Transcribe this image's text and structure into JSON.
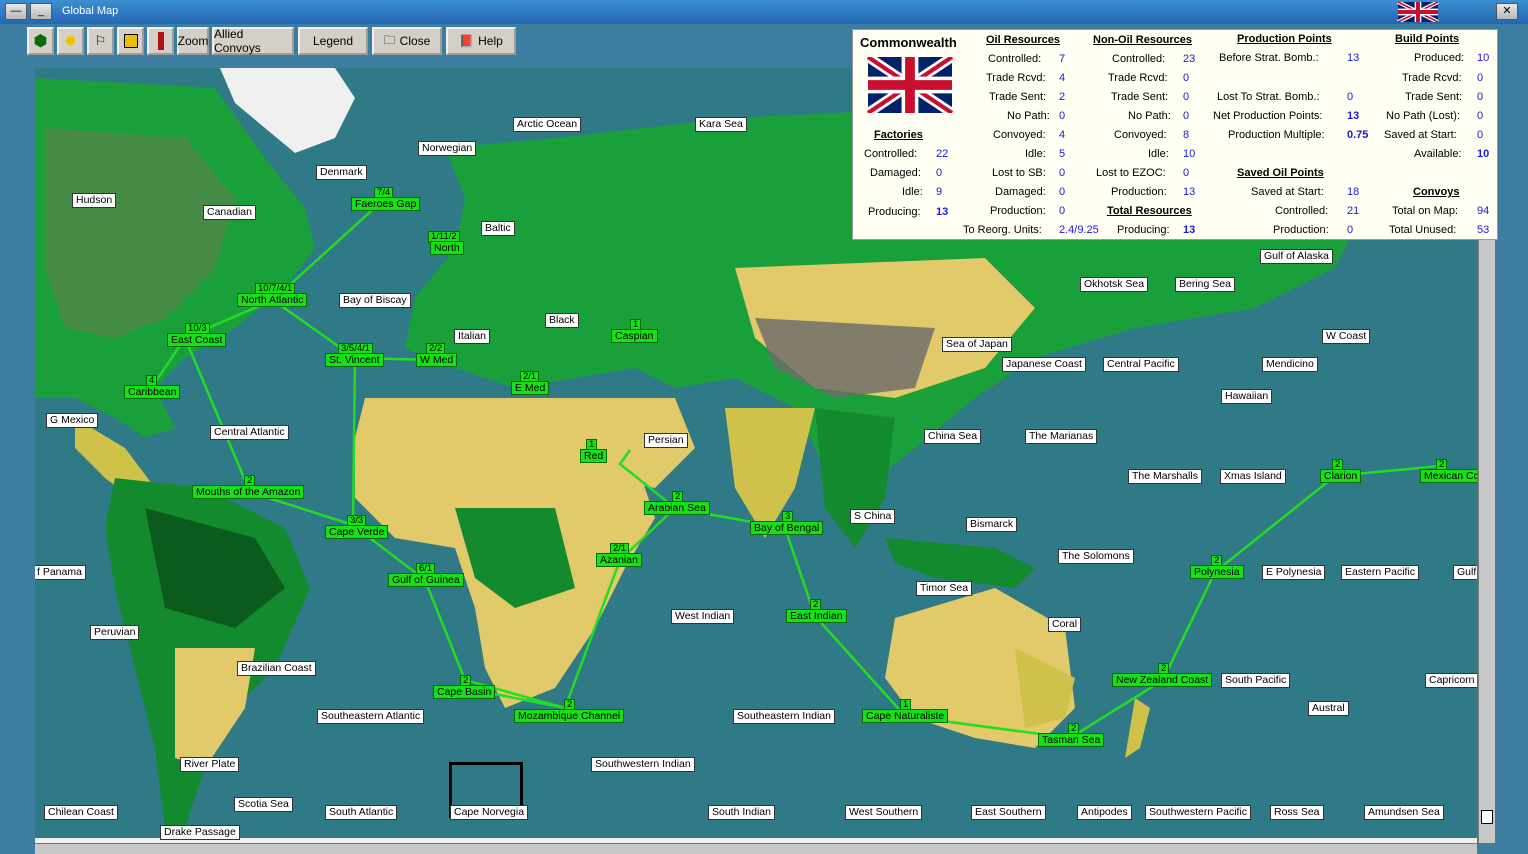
{
  "window": {
    "title": "Global Map"
  },
  "toolbar": {
    "zoom": "Zoom",
    "allied_convoys": "Allied Convoys",
    "legend": "Legend",
    "close": "Close",
    "help": "Help"
  },
  "panel": {
    "nation": "Commonwealth",
    "oil": {
      "header": "Oil Resources",
      "controlled_l": "Controlled:",
      "controlled": "7",
      "trade_rcvd_l": "Trade Rcvd:",
      "trade_rcvd": "4",
      "trade_sent_l": "Trade Sent:",
      "trade_sent": "2",
      "no_path_l": "No Path:",
      "no_path": "0",
      "convoyed_l": "Convoyed:",
      "convoyed": "4",
      "idle_l": "Idle:",
      "idle": "5",
      "lost_sb_l": "Lost to SB:",
      "lost_sb": "0",
      "damaged_l": "Damaged:",
      "damaged": "0",
      "production_l": "Production:",
      "production": "0",
      "reorg_l": "To Reorg. Units:",
      "reorg": "2.4/9.25"
    },
    "nonoil": {
      "header": "Non-Oil Resources",
      "controlled_l": "Controlled:",
      "controlled": "23",
      "trade_rcvd_l": "Trade Rcvd:",
      "trade_rcvd": "0",
      "trade_sent_l": "Trade Sent:",
      "trade_sent": "0",
      "no_path_l": "No Path:",
      "no_path": "0",
      "convoyed_l": "Convoyed:",
      "convoyed": "8",
      "idle_l": "Idle:",
      "idle": "10",
      "lost_ezoc_l": "Lost to EZOC:",
      "lost_ezoc": "0",
      "production_l": "Production:",
      "production": "13"
    },
    "total": {
      "header": "Total Resources",
      "producing_l": "Producing:",
      "producing": "13"
    },
    "factories": {
      "header": "Factories",
      "controlled_l": "Controlled:",
      "controlled": "22",
      "damaged_l": "Damaged:",
      "damaged": "0",
      "idle_l": "Idle:",
      "idle": "9",
      "producing_l": "Producing:",
      "producing": "13"
    },
    "pp": {
      "header": "Production Points",
      "before_l": "Before Strat. Bomb.:",
      "before": "13",
      "lost_l": "Lost To Strat. Bomb.:",
      "lost": "0",
      "net_l": "Net Production Points:",
      "net": "13",
      "mult_l": "Production Multiple:",
      "mult": "0.75"
    },
    "saved_oil": {
      "header": "Saved Oil Points",
      "start_l": "Saved at Start:",
      "start": "18",
      "controlled_l": "Controlled:",
      "controlled": "21",
      "production_l": "Production:",
      "production": "0"
    },
    "bp": {
      "header": "Build Points",
      "produced_l": "Produced:",
      "produced": "10",
      "trade_rcvd_l": "Trade Rcvd:",
      "trade_rcvd": "0",
      "trade_sent_l": "Trade Sent:",
      "trade_sent": "0",
      "no_path_l": "No Path (Lost):",
      "no_path": "0",
      "saved_l": "Saved at Start:",
      "saved": "0",
      "available_l": "Available:",
      "available": "10"
    },
    "convoys": {
      "header": "Convoys",
      "total_l": "Total on Map:",
      "total": "94",
      "unused_l": "Total Unused:",
      "unused": "53"
    }
  },
  "map": {
    "seas": [
      "Arctic Ocean",
      "Kara Sea",
      "Norwegian",
      "Denmark",
      "Hudson",
      "Canadian",
      "Baltic",
      "Bay of Biscay",
      "Italian",
      "Black",
      "Gulf of Alaska",
      "Okhotsk Sea",
      "Bering Sea",
      "W Coast",
      "Sea of Japan",
      "Japanese Coast",
      "Central Pacific",
      "Mendicino",
      "Hawaiian",
      "G Mexico",
      "Central Atlantic",
      "Persian",
      "China Sea",
      "The Marianas",
      "The Marshalls",
      "Xmas Island",
      "S China",
      "Bismarck",
      "The Solomons",
      "f Panama",
      "E Polynesia",
      "Eastern Pacific",
      "Gulf",
      "West Indian",
      "Timor Sea",
      "Coral",
      "Peruvian",
      "Brazilian Coast",
      "South Pacific",
      "Capricorn",
      "Austral",
      "Southeastern Atlantic",
      "Southeastern Indian",
      "River Plate",
      "Southwestern Indian",
      "Scotia Sea",
      "Chilean Coast",
      "South Atlantic",
      "Cape Norvegia",
      "South Indian",
      "West Southern",
      "East Southern",
      "Antipodes",
      "Southwestern Pacific",
      "Ross Sea",
      "Amundsen Sea",
      "Drake Passage"
    ],
    "convoys": [
      {
        "name": "Faeroes Gap",
        "count": "7/4"
      },
      {
        "name": "North",
        "count": "1/11/2"
      },
      {
        "name": "North Atlantic",
        "count": "10/7/4/1"
      },
      {
        "name": "East Coast",
        "count": "10/3"
      },
      {
        "name": "St. Vincent",
        "count": "3/5/4/1"
      },
      {
        "name": "W Med",
        "count": "2/2"
      },
      {
        "name": "Caspian",
        "count": "1"
      },
      {
        "name": "E Med",
        "count": "2/1"
      },
      {
        "name": "Caribbean",
        "count": "4"
      },
      {
        "name": "Red",
        "count": "1"
      },
      {
        "name": "Arabian Sea",
        "count": "2"
      },
      {
        "name": "Bay of Bengal",
        "count": "3"
      },
      {
        "name": "Mouths of the Amazon",
        "count": "2"
      },
      {
        "name": "Cape Verde",
        "count": "3/3"
      },
      {
        "name": "Azanian",
        "count": "2/1"
      },
      {
        "name": "Gulf of Guinea",
        "count": "6/1"
      },
      {
        "name": "East Indian",
        "count": "2"
      },
      {
        "name": "Clarion",
        "count": "2"
      },
      {
        "name": "Mexican Coast",
        "count": "2"
      },
      {
        "name": "Polynesia",
        "count": "2"
      },
      {
        "name": "New Zealand Coast",
        "count": "2"
      },
      {
        "name": "Cape Basin",
        "count": "2"
      },
      {
        "name": "Mozambique Channel",
        "count": "2"
      },
      {
        "name": "Cape Naturaliste",
        "count": "1"
      },
      {
        "name": "Tasman Sea",
        "count": "2"
      }
    ]
  }
}
